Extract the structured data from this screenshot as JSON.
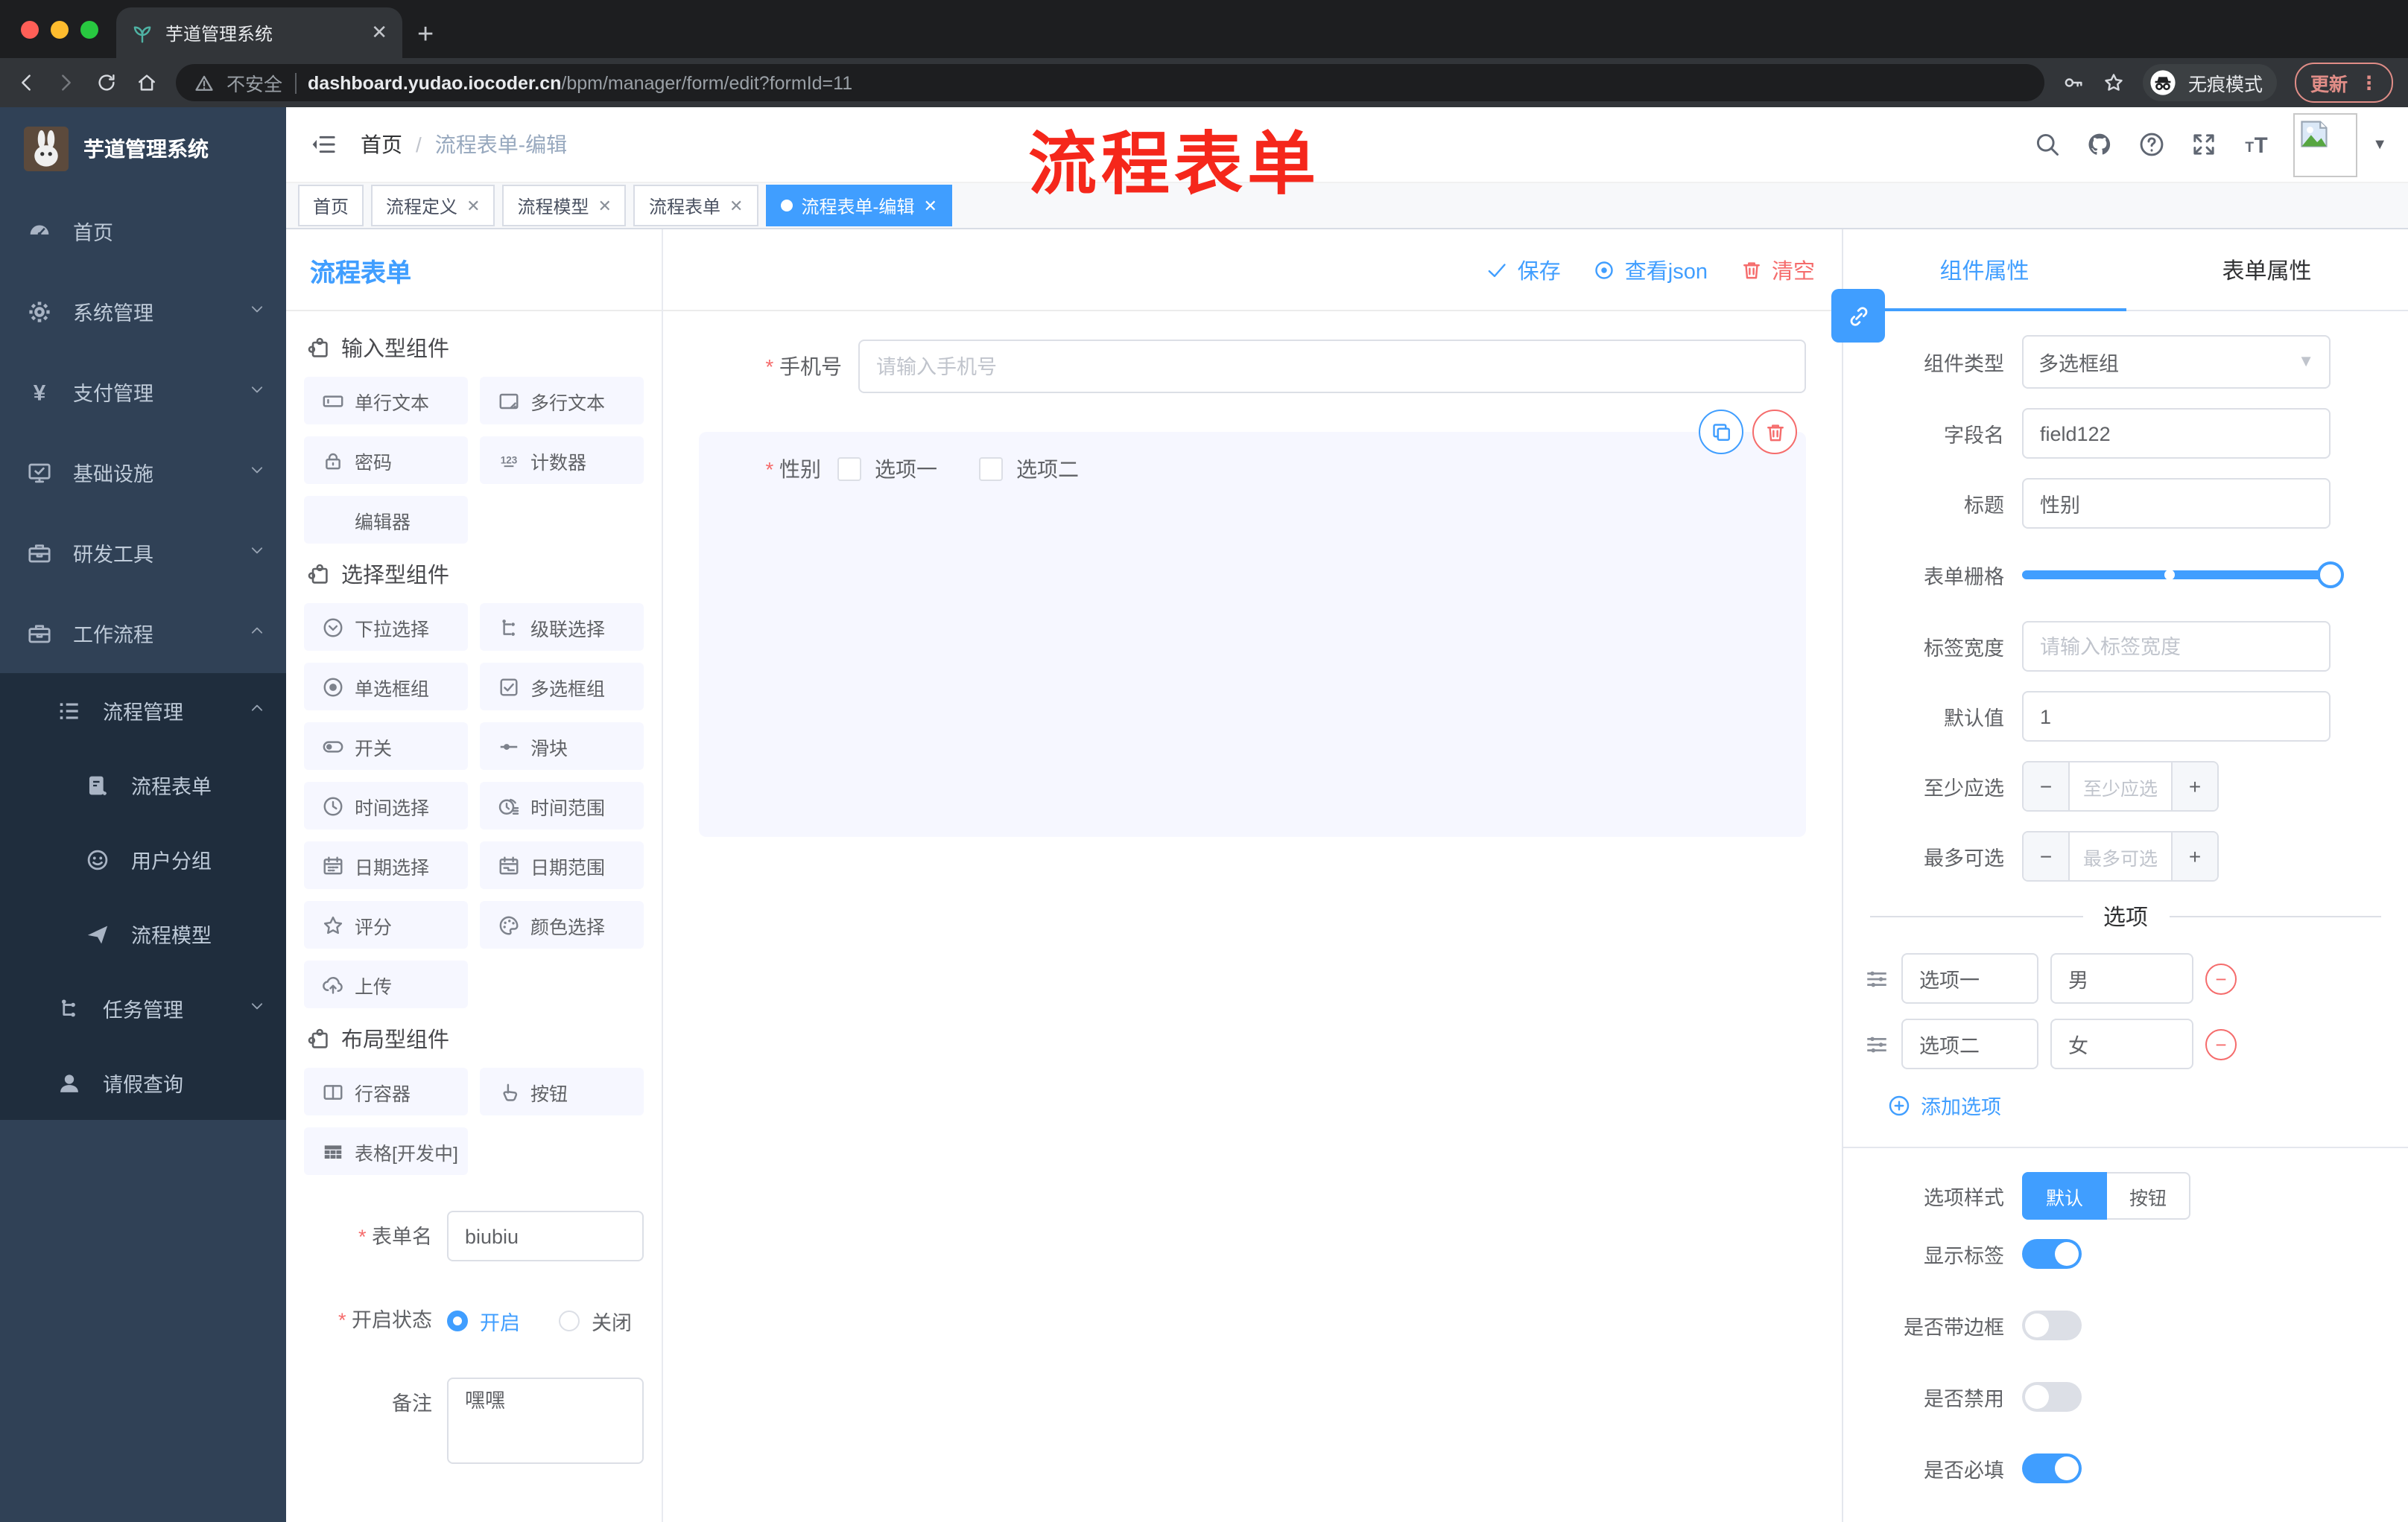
{
  "colors": {
    "accent": "#409EFF",
    "danger": "#F56C6C",
    "annotation": "#F5271B",
    "sidebar_bg": "#304156",
    "submenu_bg": "#1F2D3D"
  },
  "browser": {
    "tab_title": "芋道管理系统",
    "security_label": "不安全",
    "url_domain": "dashboard.yudao.iocoder.cn",
    "url_path": "/bpm/manager/form/edit?formId=11",
    "incognito_label": "无痕模式",
    "update_label": "更新"
  },
  "annotation": {
    "text": "流程表单"
  },
  "sidebar": {
    "title": "芋道管理系统",
    "items": [
      {
        "label": "首页",
        "icon": "dashboard-icon",
        "level": 1
      },
      {
        "label": "系统管理",
        "icon": "gear-icon",
        "level": 1,
        "chevron": "down"
      },
      {
        "label": "支付管理",
        "icon": "yen-icon",
        "level": 1,
        "chevron": "down"
      },
      {
        "label": "基础设施",
        "icon": "monitor-icon",
        "level": 1,
        "chevron": "down"
      },
      {
        "label": "研发工具",
        "icon": "toolbox-icon",
        "level": 1,
        "chevron": "down"
      },
      {
        "label": "工作流程",
        "icon": "briefcase-icon",
        "level": 1,
        "chevron": "up"
      },
      {
        "label": "流程管理",
        "icon": "list-icon",
        "level": 2,
        "chevron": "up",
        "dark": true
      },
      {
        "label": "流程表单",
        "icon": "form-doc-icon",
        "level": 3,
        "dark": true
      },
      {
        "label": "用户分组",
        "icon": "face-icon",
        "level": 3,
        "dark": true
      },
      {
        "label": "流程模型",
        "icon": "send-icon",
        "level": 3,
        "dark": true
      },
      {
        "label": "任务管理",
        "icon": "tasks-icon",
        "level": 2,
        "chevron": "down",
        "dark": true
      },
      {
        "label": "请假查询",
        "icon": "user-icon",
        "level": 2,
        "dark": true
      }
    ]
  },
  "header": {
    "breadcrumb": {
      "home": "首页",
      "separator": "/",
      "current": "流程表单-编辑"
    }
  },
  "tags_bar": {
    "tags": [
      {
        "label": "首页",
        "closable": false,
        "active": false
      },
      {
        "label": "流程定义",
        "closable": true,
        "active": false
      },
      {
        "label": "流程模型",
        "closable": true,
        "active": false
      },
      {
        "label": "流程表单",
        "closable": true,
        "active": false
      },
      {
        "label": "流程表单-编辑",
        "closable": true,
        "active": true
      }
    ]
  },
  "designer": {
    "panel_title": "流程表单",
    "toolbar": {
      "save": "保存",
      "view_json": "查看json",
      "clear": "清空"
    },
    "groups": [
      {
        "title": "输入型组件",
        "items": [
          {
            "label": "单行文本",
            "icon": "input-icon"
          },
          {
            "label": "多行文本",
            "icon": "textarea-icon"
          },
          {
            "label": "密码",
            "icon": "lock-icon"
          },
          {
            "label": "计数器",
            "icon": "counter-icon"
          },
          {
            "label": "编辑器",
            "icon": "none"
          }
        ]
      },
      {
        "title": "选择型组件",
        "items": [
          {
            "label": "下拉选择",
            "icon": "select-icon"
          },
          {
            "label": "级联选择",
            "icon": "cascader-icon"
          },
          {
            "label": "单选框组",
            "icon": "radio-icon"
          },
          {
            "label": "多选框组",
            "icon": "checkbox-icon"
          },
          {
            "label": "开关",
            "icon": "switch-icon"
          },
          {
            "label": "滑块",
            "icon": "slider-icon"
          },
          {
            "label": "时间选择",
            "icon": "time-icon"
          },
          {
            "label": "时间范围",
            "icon": "time-range-icon"
          },
          {
            "label": "日期选择",
            "icon": "date-icon"
          },
          {
            "label": "日期范围",
            "icon": "date-range-icon"
          },
          {
            "label": "评分",
            "icon": "star-icon"
          },
          {
            "label": "颜色选择",
            "icon": "color-icon"
          },
          {
            "label": "上传",
            "icon": "upload-icon"
          }
        ]
      },
      {
        "title": "布局型组件",
        "items": [
          {
            "label": "行容器",
            "icon": "row-container-icon"
          },
          {
            "label": "按钮",
            "icon": "hand-icon"
          },
          {
            "label": "表格[开发中]",
            "icon": "table-icon"
          }
        ]
      }
    ],
    "form_meta": {
      "name_label": "表单名",
      "name_value": "biubiu",
      "status_label": "开启状态",
      "status_on": "开启",
      "status_off": "关闭",
      "remark_label": "备注",
      "remark_value": "嘿嘿"
    },
    "canvas": {
      "phone": {
        "label": "手机号",
        "placeholder": "请输入手机号"
      },
      "gender": {
        "label": "性别",
        "options": [
          "选项一",
          "选项二"
        ]
      }
    }
  },
  "properties": {
    "tabs": {
      "component": "组件属性",
      "form": "表单属性"
    },
    "component_type": {
      "label": "组件类型",
      "value": "多选框组"
    },
    "field_name": {
      "label": "字段名",
      "value": "field122"
    },
    "title": {
      "label": "标题",
      "value": "性别"
    },
    "grid": {
      "label": "表单栅格"
    },
    "label_width": {
      "label": "标签宽度",
      "placeholder": "请输入标签宽度"
    },
    "default_value": {
      "label": "默认值",
      "value": "1"
    },
    "min_select": {
      "label": "至少应选",
      "placeholder": "至少应选"
    },
    "max_select": {
      "label": "最多可选",
      "placeholder": "最多可选"
    },
    "options": {
      "divider": "选项",
      "add": "添加选项",
      "rows": [
        {
          "label": "选项一",
          "value": "男"
        },
        {
          "label": "选项二",
          "value": "女"
        }
      ]
    },
    "style": {
      "label": "选项样式",
      "choices": [
        "默认",
        "按钮"
      ],
      "selected": "默认"
    },
    "switches": [
      {
        "label": "显示标签",
        "on": true
      },
      {
        "label": "是否带边框",
        "on": false
      },
      {
        "label": "是否禁用",
        "on": false
      },
      {
        "label": "是否必填",
        "on": true
      }
    ]
  }
}
